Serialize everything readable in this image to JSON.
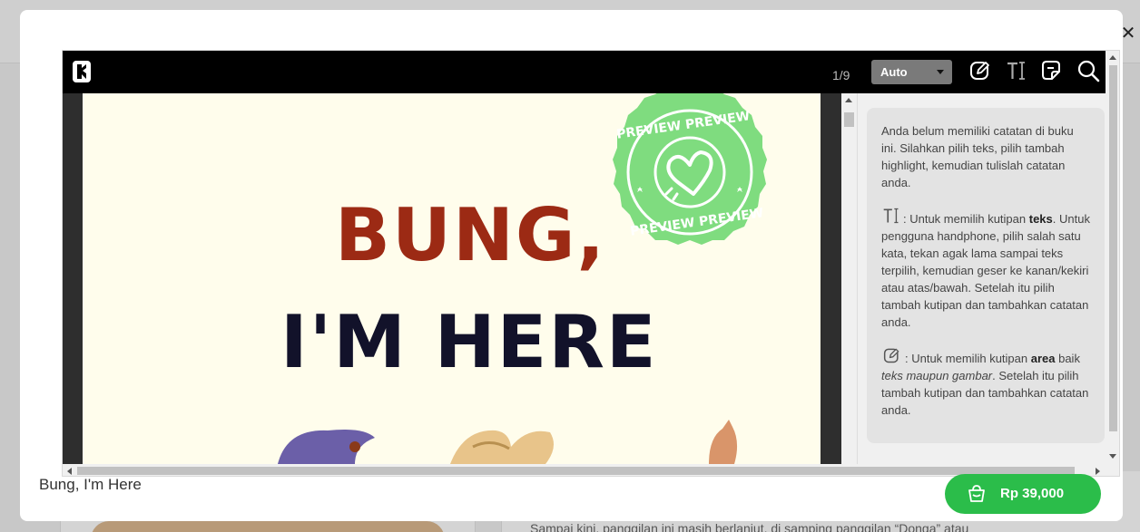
{
  "background": {
    "visible_text": "Sampai kini, panggilan ini masih berlanjut, di samping panggilan “Donga” atau"
  },
  "reader": {
    "page_counter": "1/9",
    "zoom": "Auto",
    "toolbar_icons": [
      "edit-area-icon",
      "text-select-icon",
      "notes-icon",
      "search-icon"
    ],
    "page": {
      "title_line_1": "BUNG,",
      "title_line_2": "I'M HERE",
      "stamp_text": "PREVIEW PREVIEW"
    }
  },
  "notes": {
    "empty_message": "Anda belum memiliki catatan di buku ini. Silahkan pilih teks, pilih tambah highlight, kemudian tulislah catatan anda.",
    "text_help": {
      "prefix": ": Untuk memilih kutipan ",
      "bold": "teks",
      "rest": ". Untuk pengguna handphone, pilih salah satu kata, tekan agak lama sampai teks terpilih, kemudian geser ke kanan/kekiri atau atas/bawah. Setelah itu pilih tambah kutipan dan tambahkan catatan anda."
    },
    "area_help": {
      "prefix": ": Untuk memilih kutipan ",
      "bold": "area",
      "middle": " baik ",
      "italic": "teks maupun gambar",
      "rest": ". Setelah itu pilih tambah kutipan dan tambahkan catatan anda."
    }
  },
  "footer": {
    "book_name": "Bung, I'm Here",
    "price": "Rp 39,000"
  },
  "colors": {
    "buy_button": "#2bbd4a",
    "stamp": "#7fdc7f",
    "title_red": "#9c2a14",
    "title_dark": "#12122a"
  }
}
